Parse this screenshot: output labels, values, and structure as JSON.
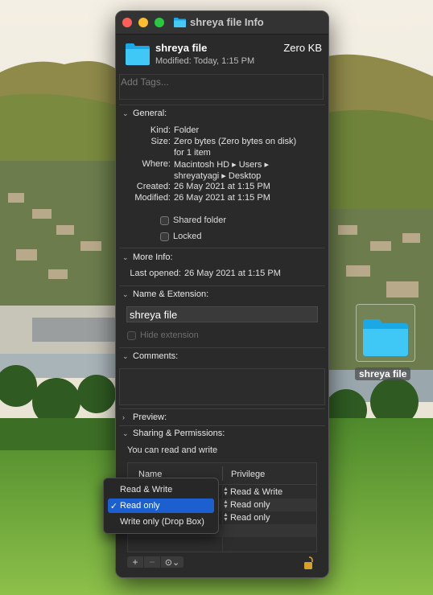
{
  "window": {
    "title": "shreya file Info",
    "file_name": "shreya file",
    "size_label": "Zero KB",
    "modified_line": "Modified:  Today, 1:15 PM",
    "tags_placeholder": "Add Tags..."
  },
  "general": {
    "header": "General:",
    "kind_label": "Kind:",
    "kind_value": "Folder",
    "size_label": "Size:",
    "size_value_1": "Zero bytes (Zero bytes on disk)",
    "size_value_2": "for 1 item",
    "where_label": "Where:",
    "where_value_1": "Macintosh HD ▸ Users ▸",
    "where_value_2": "shreyatyagi ▸ Desktop",
    "created_label": "Created:",
    "created_value": "26 May 2021 at 1:15 PM",
    "modified_label": "Modified:",
    "modified_value": "26 May 2021 at 1:15 PM",
    "shared_folder": "Shared folder",
    "locked": "Locked"
  },
  "more_info": {
    "header": "More Info:",
    "last_opened_label": "Last opened:",
    "last_opened_value": "26 May 2021 at 1:15 PM"
  },
  "name_extension": {
    "header": "Name & Extension:",
    "name_value": "shreya file",
    "hide_extension": "Hide extension"
  },
  "comments": {
    "header": "Comments:"
  },
  "preview": {
    "header": "Preview:"
  },
  "sharing": {
    "header": "Sharing & Permissions:",
    "summary": "You can read and write",
    "col_name": "Name",
    "col_privilege": "Privilege",
    "rows": [
      {
        "privilege": "Read & Write"
      },
      {
        "privilege": "Read only"
      },
      {
        "privilege": "Read only"
      }
    ],
    "add_button": "+",
    "remove_button": "−",
    "action_button": "⊙⌄"
  },
  "popup_menu": {
    "items": [
      "Read & Write",
      "Read only",
      "Write only (Drop Box)"
    ],
    "selected": "Read only",
    "check": "✓"
  },
  "desktop": {
    "icon_label": "shreya file"
  }
}
